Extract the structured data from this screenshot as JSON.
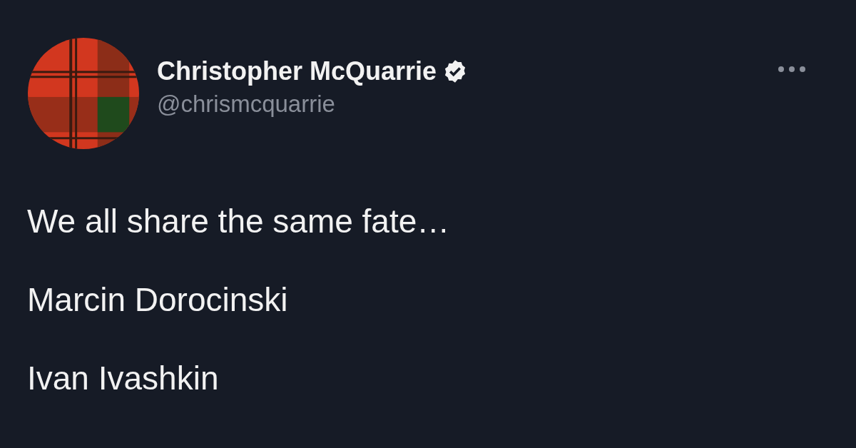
{
  "author": {
    "name": "Christopher McQuarrie",
    "verified": true,
    "handle": "@chrismcquarrie"
  },
  "tweet": {
    "lines": [
      "We all share the same fate…",
      "Marcin Dorocinski",
      "Ivan Ivashkin"
    ]
  }
}
